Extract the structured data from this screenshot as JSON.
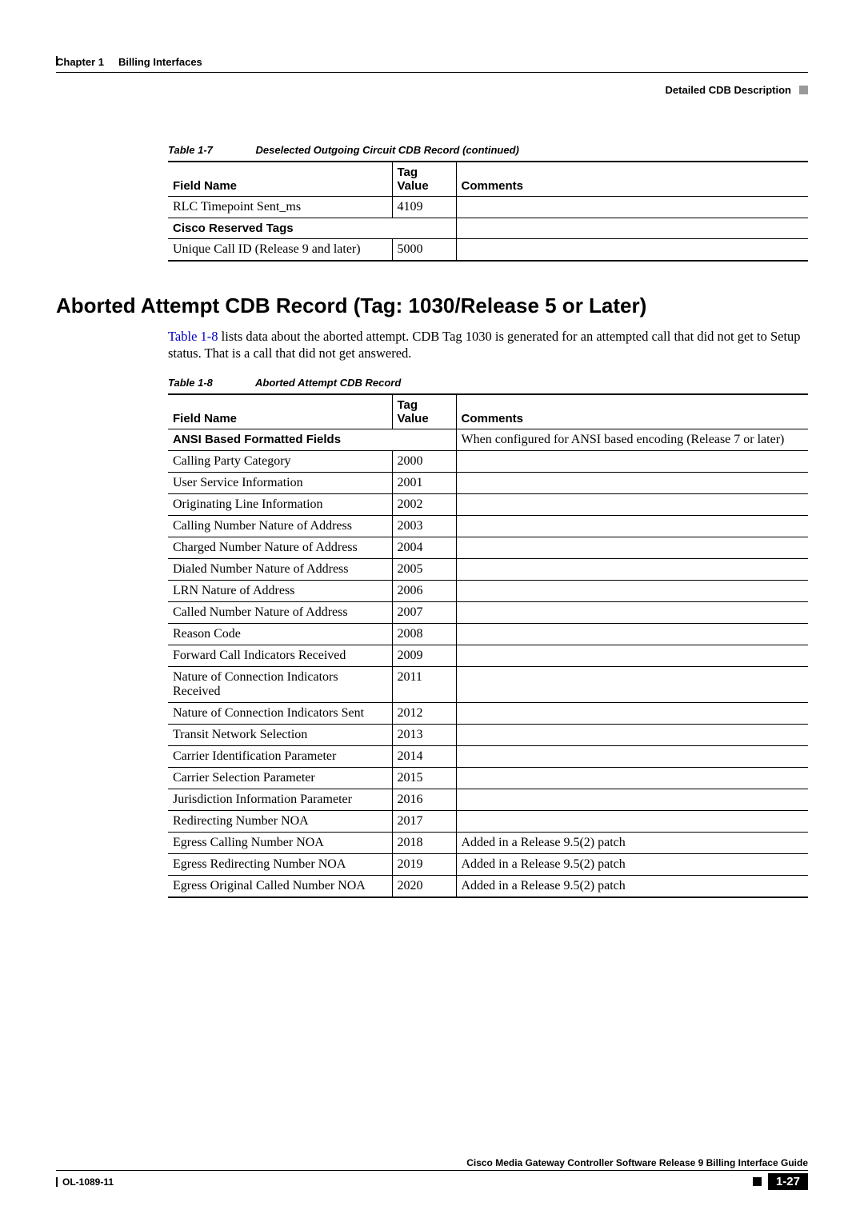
{
  "header": {
    "chapter": "Chapter 1",
    "title": "Billing Interfaces",
    "section": "Detailed CDB Description"
  },
  "table7": {
    "caption_num": "Table 1-7",
    "caption_title": "Deselected Outgoing Circuit CDB Record (continued)",
    "headers": {
      "field": "Field Name",
      "tag": "Tag Value",
      "comments": "Comments"
    },
    "rows": [
      {
        "field": "RLC Timepoint Sent_ms",
        "tag": "4109",
        "comments": ""
      }
    ],
    "section_label": "Cisco Reserved Tags",
    "section_rows": [
      {
        "field": "Unique Call ID (Release 9 and later)",
        "tag": "5000",
        "comments": ""
      }
    ]
  },
  "heading": "Aborted Attempt CDB Record (Tag: 1030/Release 5 or Later)",
  "paragraph": {
    "link": "Table 1-8",
    "text": " lists data about the aborted attempt. CDB Tag 1030 is generated for an attempted call that did not get to Setup status. That is a call that did not get answered."
  },
  "table8": {
    "caption_num": "Table 1-8",
    "caption_title": "Aborted Attempt CDB Record",
    "headers": {
      "field": "Field Name",
      "tag": "Tag Value",
      "comments": "Comments"
    },
    "section_label": "ANSI Based Formatted Fields",
    "section_comment": "When configured for ANSI based encoding (Release 7 or later)",
    "rows": [
      {
        "field": "Calling Party Category",
        "tag": "2000",
        "comments": ""
      },
      {
        "field": "User Service Information",
        "tag": "2001",
        "comments": ""
      },
      {
        "field": "Originating Line Information",
        "tag": "2002",
        "comments": ""
      },
      {
        "field": "Calling Number Nature of Address",
        "tag": "2003",
        "comments": ""
      },
      {
        "field": "Charged Number Nature of Address",
        "tag": "2004",
        "comments": ""
      },
      {
        "field": "Dialed Number Nature of Address",
        "tag": "2005",
        "comments": ""
      },
      {
        "field": "LRN Nature of Address",
        "tag": "2006",
        "comments": ""
      },
      {
        "field": "Called Number Nature of Address",
        "tag": "2007",
        "comments": ""
      },
      {
        "field": "Reason Code",
        "tag": "2008",
        "comments": ""
      },
      {
        "field": "Forward Call Indicators Received",
        "tag": "2009",
        "comments": ""
      },
      {
        "field": "Nature of Connection Indicators Received",
        "tag": "2011",
        "comments": ""
      },
      {
        "field": "Nature of Connection Indicators Sent",
        "tag": "2012",
        "comments": ""
      },
      {
        "field": "Transit Network Selection",
        "tag": "2013",
        "comments": ""
      },
      {
        "field": "Carrier Identification Parameter",
        "tag": "2014",
        "comments": ""
      },
      {
        "field": "Carrier Selection Parameter",
        "tag": "2015",
        "comments": ""
      },
      {
        "field": "Jurisdiction Information Parameter",
        "tag": "2016",
        "comments": ""
      },
      {
        "field": "Redirecting Number NOA",
        "tag": "2017",
        "comments": ""
      },
      {
        "field": "Egress Calling Number NOA",
        "tag": "2018",
        "comments": "Added in a Release 9.5(2) patch"
      },
      {
        "field": "Egress Redirecting Number NOA",
        "tag": "2019",
        "comments": "Added in a Release 9.5(2) patch"
      },
      {
        "field": "Egress Original Called Number NOA",
        "tag": "2020",
        "comments": "Added in a Release 9.5(2) patch"
      }
    ]
  },
  "footer": {
    "guide": "Cisco Media Gateway Controller Software Release 9 Billing Interface Guide",
    "doc": "OL-1089-11",
    "page": "1-27"
  }
}
